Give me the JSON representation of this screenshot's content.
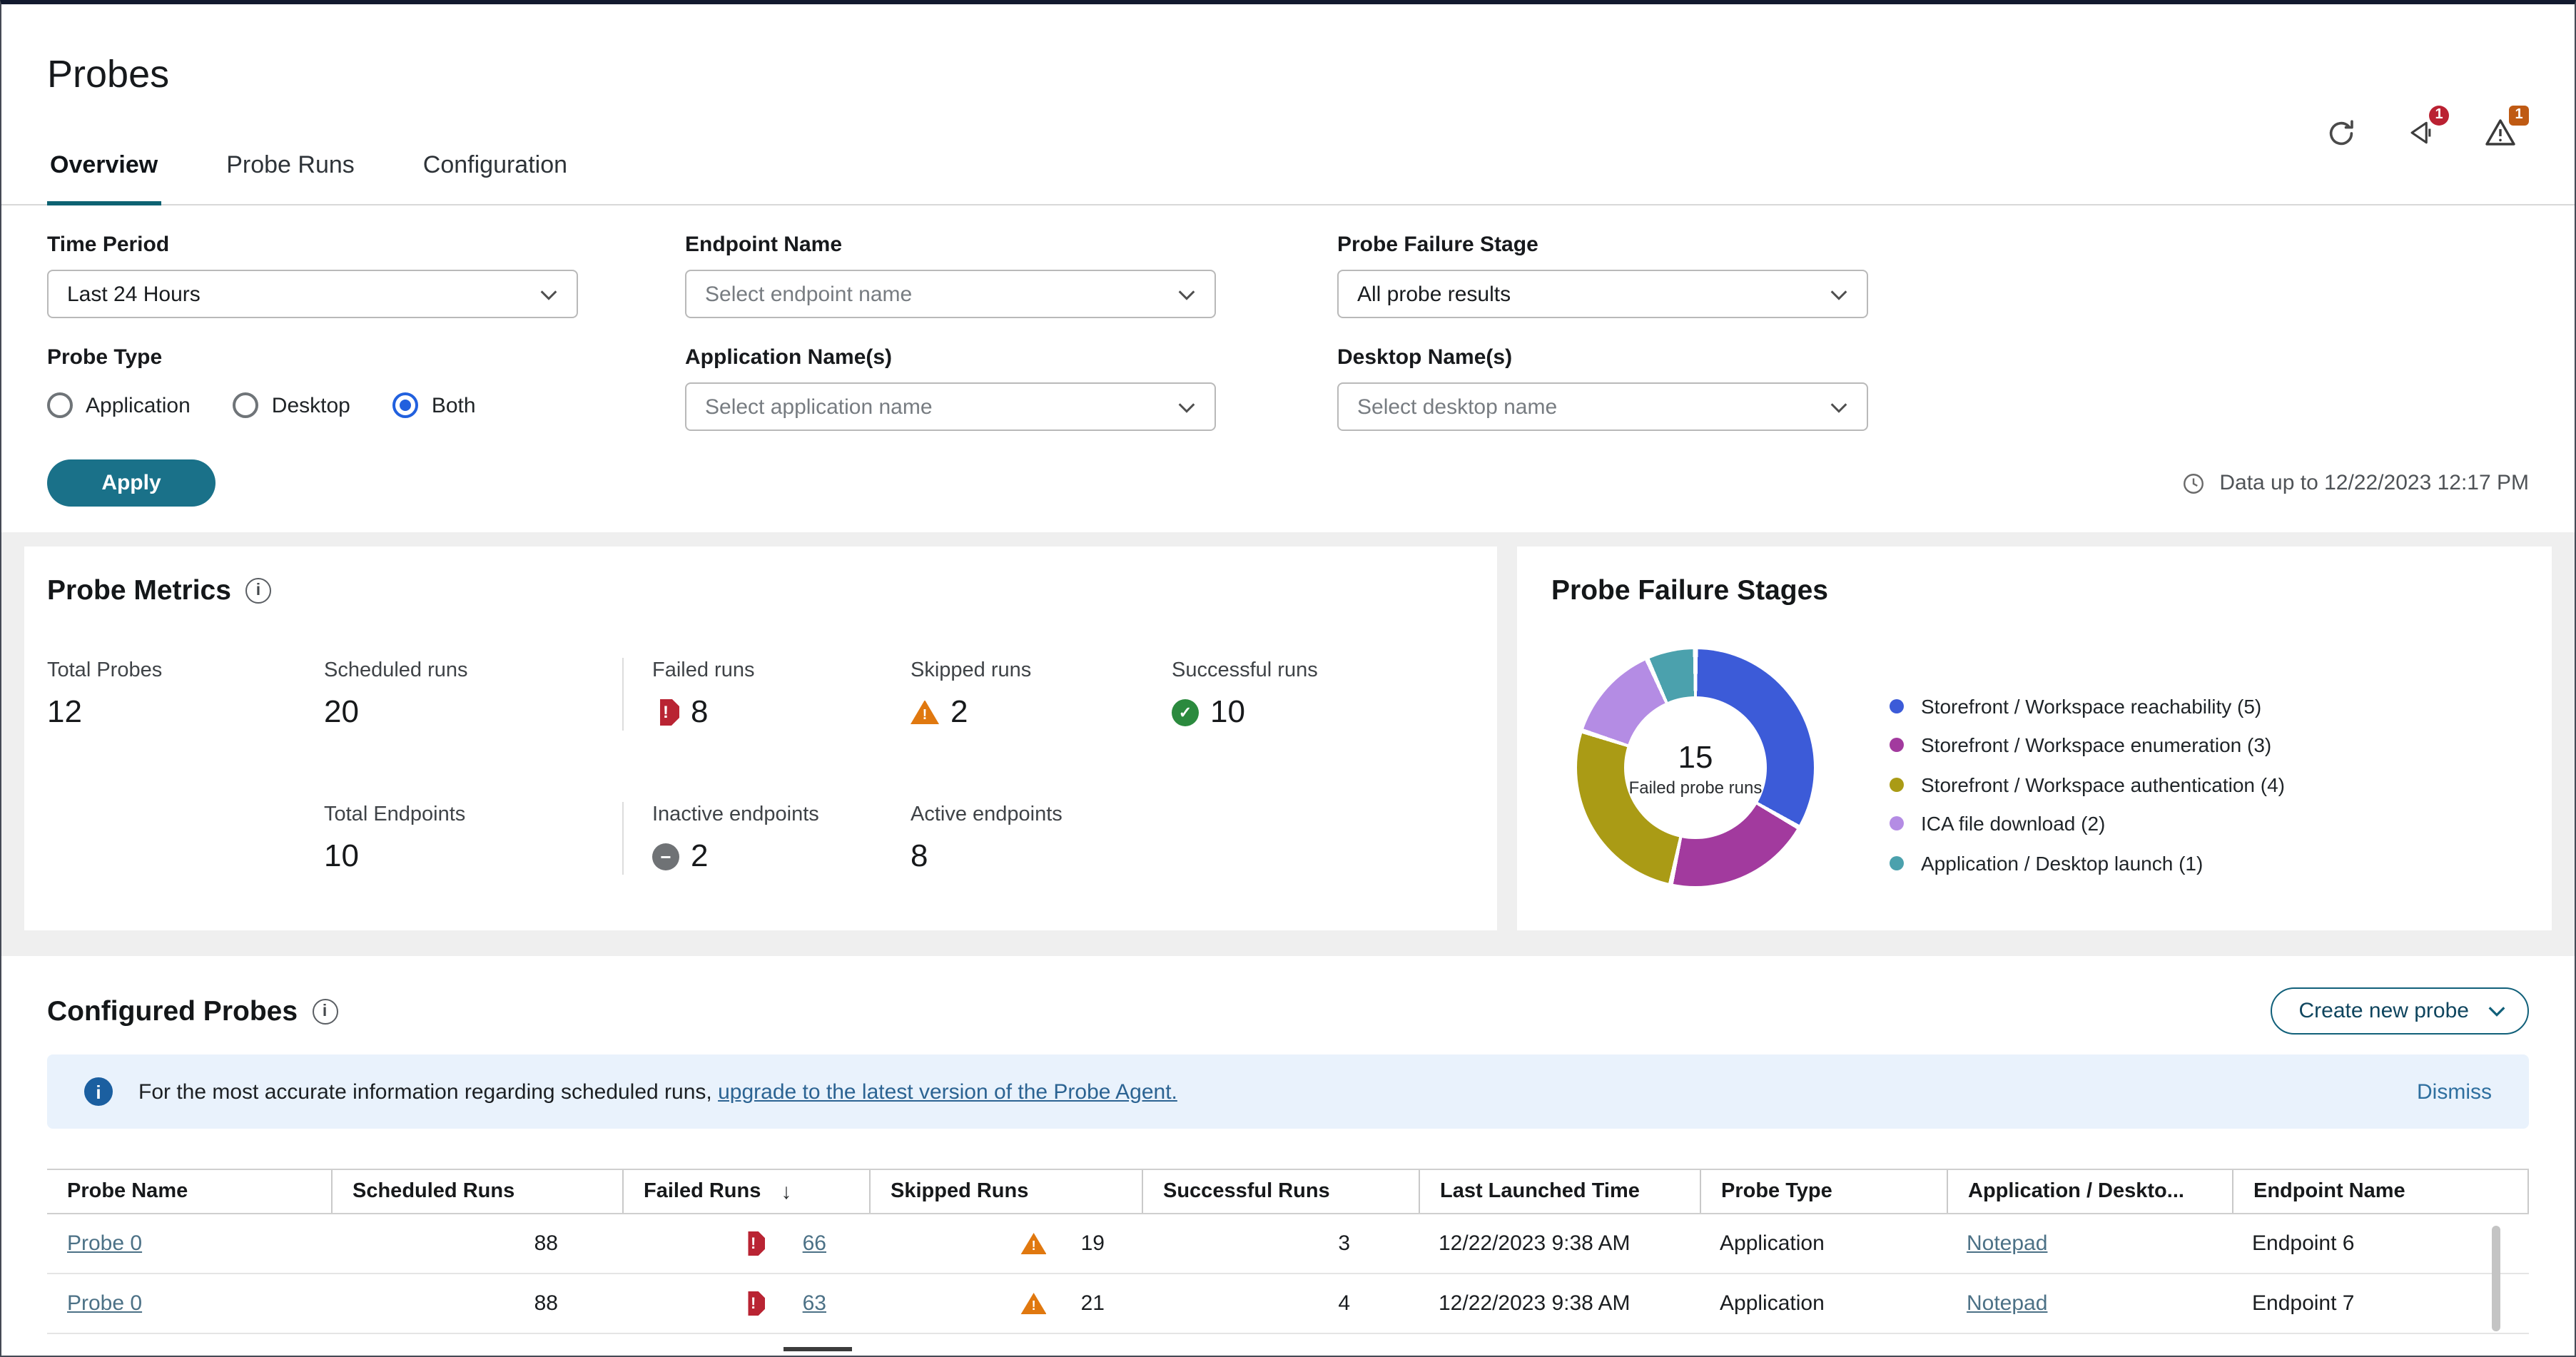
{
  "header": {
    "title": "Probes",
    "tabs": [
      {
        "label": "Overview",
        "active": true
      },
      {
        "label": "Probe Runs",
        "active": false
      },
      {
        "label": "Configuration",
        "active": false
      }
    ],
    "badges": {
      "announcements": "1",
      "alerts": "1"
    }
  },
  "filters": {
    "time_period": {
      "label": "Time Period",
      "value": "Last 24 Hours"
    },
    "endpoint_name": {
      "label": "Endpoint Name",
      "placeholder": "Select endpoint name"
    },
    "probe_failure_stage": {
      "label": "Probe Failure Stage",
      "value": "All probe results"
    },
    "probe_type": {
      "label": "Probe Type",
      "options": [
        {
          "label": "Application",
          "selected": false
        },
        {
          "label": "Desktop",
          "selected": false
        },
        {
          "label": "Both",
          "selected": true
        }
      ]
    },
    "application_names": {
      "label": "Application Name(s)",
      "placeholder": "Select application name"
    },
    "desktop_names": {
      "label": "Desktop Name(s)",
      "placeholder": "Select desktop name"
    },
    "apply_label": "Apply",
    "data_up_to": "Data up to 12/22/2023 12:17 PM"
  },
  "probe_metrics": {
    "title": "Probe Metrics",
    "row1": [
      {
        "label": "Total Probes",
        "value": "12",
        "icon": "none"
      },
      {
        "label": "Scheduled runs",
        "value": "20",
        "icon": "none"
      },
      {
        "label": "Failed runs",
        "value": "8",
        "icon": "failed"
      },
      {
        "label": "Skipped runs",
        "value": "2",
        "icon": "skipped"
      },
      {
        "label": "Successful runs",
        "value": "10",
        "icon": "success"
      }
    ],
    "row2": [
      {
        "label": "Total Endpoints",
        "value": "10",
        "icon": "none"
      },
      {
        "label": "Inactive endpoints",
        "value": "2",
        "icon": "inactive"
      },
      {
        "label": "Active endpoints",
        "value": "8",
        "icon": "none"
      }
    ]
  },
  "probe_failure_stages": {
    "title": "Probe Failure Stages",
    "chart_data": {
      "type": "pie",
      "donut": true,
      "center_value": "15",
      "center_label": "Failed probe runs",
      "total": 15,
      "legend_position": "right",
      "segments": [
        {
          "label": "Storefront / Workspace reachability",
          "value": 5,
          "color": "#3c5bd8"
        },
        {
          "label": "Storefront / Workspace enumeration",
          "value": 3,
          "color": "#a23a9e"
        },
        {
          "label": "Storefront / Workspace authentication",
          "value": 4,
          "color": "#aa9b15"
        },
        {
          "label": "ICA file download",
          "value": 2,
          "color": "#b48ce4"
        },
        {
          "label": "Application / Desktop launch",
          "value": 1,
          "color": "#4ba1ad"
        }
      ]
    }
  },
  "configured_probes": {
    "title": "Configured Probes",
    "create_button_label": "Create new probe",
    "banner": {
      "text": "For the most accurate information regarding scheduled runs, ",
      "link_text": "upgrade to the latest version of the Probe Agent.",
      "dismiss_label": "Dismiss"
    },
    "table": {
      "columns": [
        "Probe Name",
        "Scheduled Runs",
        "Failed Runs",
        "Skipped Runs",
        "Successful Runs",
        "Last Launched Time",
        "Probe Type",
        "Application / Deskto...",
        "Endpoint Name"
      ],
      "sorted_by": "Failed Runs",
      "sort_direction": "descending",
      "rows": [
        {
          "probe_name": "Probe 0",
          "scheduled_runs": "88",
          "failed_runs": "66",
          "skipped_runs": "19",
          "successful_runs": "3",
          "last_launched_time": "12/22/2023 9:38 AM",
          "probe_type": "Application",
          "application_desktop": "Notepad",
          "endpoint_name": "Endpoint 6"
        },
        {
          "probe_name": "Probe 0",
          "scheduled_runs": "88",
          "failed_runs": "63",
          "skipped_runs": "21",
          "successful_runs": "4",
          "last_launched_time": "12/22/2023 9:38 AM",
          "probe_type": "Application",
          "application_desktop": "Notepad",
          "endpoint_name": "Endpoint 7"
        }
      ]
    }
  }
}
